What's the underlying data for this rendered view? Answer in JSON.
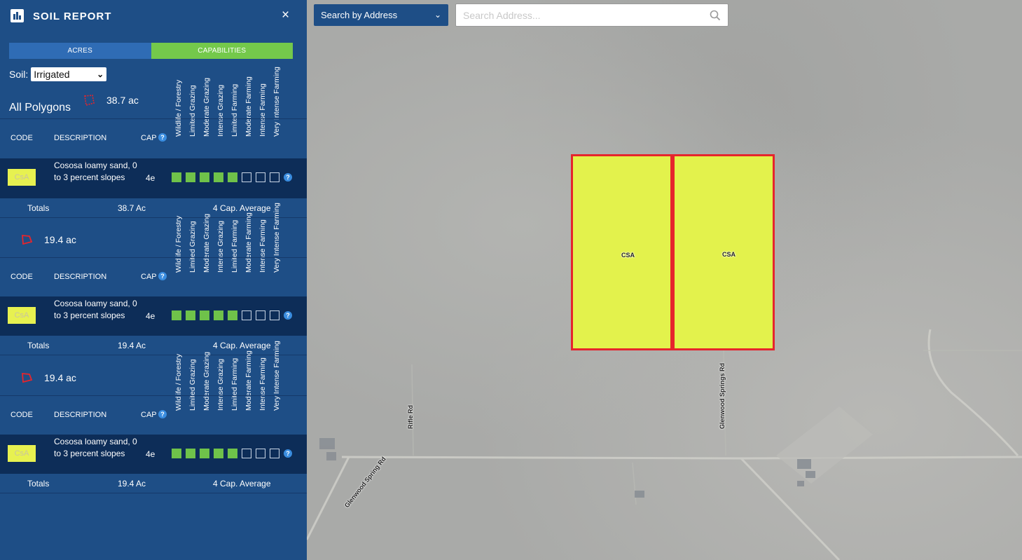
{
  "sidebar": {
    "title": "SOIL REPORT",
    "close_label": "×",
    "tabs": {
      "acres": "ACRES",
      "capabilities": "CAPABILITIES"
    },
    "soil_label": "Soil:",
    "soil_value": "Irrigated",
    "capability_labels": [
      "Wildlife / Forestry",
      "Limited Grazing",
      "Moderate Grazing",
      "Intense Grazing",
      "Limited Farming",
      "Moderate Farming",
      "Intense Farming",
      "Very Intense Farming"
    ],
    "columns": {
      "code": "CODE",
      "description": "DESCRIPTION",
      "cap": "CAP"
    },
    "info_glyph": "?",
    "sections": [
      {
        "name": "All Polygons",
        "acres": "38.7 ac",
        "row": {
          "code": "CsA",
          "description": "Cososa loamy sand, 0 to 3 percent slopes",
          "cap": "4e",
          "capability_level": 5
        },
        "totals": {
          "label": "Totals",
          "acres": "38.7 Ac",
          "average": "4 Cap. Average"
        }
      },
      {
        "name": "",
        "acres": "19.4 ac",
        "row": {
          "code": "CsA",
          "description": "Cososa loamy sand, 0 to 3 percent slopes",
          "cap": "4e",
          "capability_level": 5
        },
        "totals": {
          "label": "Totals",
          "acres": "19.4 Ac",
          "average": "4 Cap. Average"
        }
      },
      {
        "name": "",
        "acres": "19.4 ac",
        "row": {
          "code": "CsA",
          "description": "Cososa loamy sand, 0 to 3 percent slopes",
          "cap": "4e",
          "capability_level": 5
        },
        "totals": {
          "label": "Totals",
          "acres": "19.4 Ac",
          "average": "4 Cap. Average"
        }
      }
    ]
  },
  "map": {
    "search_mode": "Search by Address",
    "search_placeholder": "Search Address...",
    "parcels": [
      {
        "label": "CSA"
      },
      {
        "label": "CSA"
      }
    ],
    "roads": [
      "Glenwood Springs Rd",
      "Rifle Rd",
      "Glenwood Spring Rd"
    ]
  },
  "colors": {
    "panel": "#1e4e86",
    "row": "#0d2d58",
    "accent_green": "#74c94b",
    "soil_yellow": "#e3f24c",
    "parcel_border": "#e6252c"
  },
  "icons": [
    "bar-chart-icon",
    "close-icon",
    "chevron-down-icon",
    "polygon-icon",
    "info-icon",
    "search-icon"
  ]
}
